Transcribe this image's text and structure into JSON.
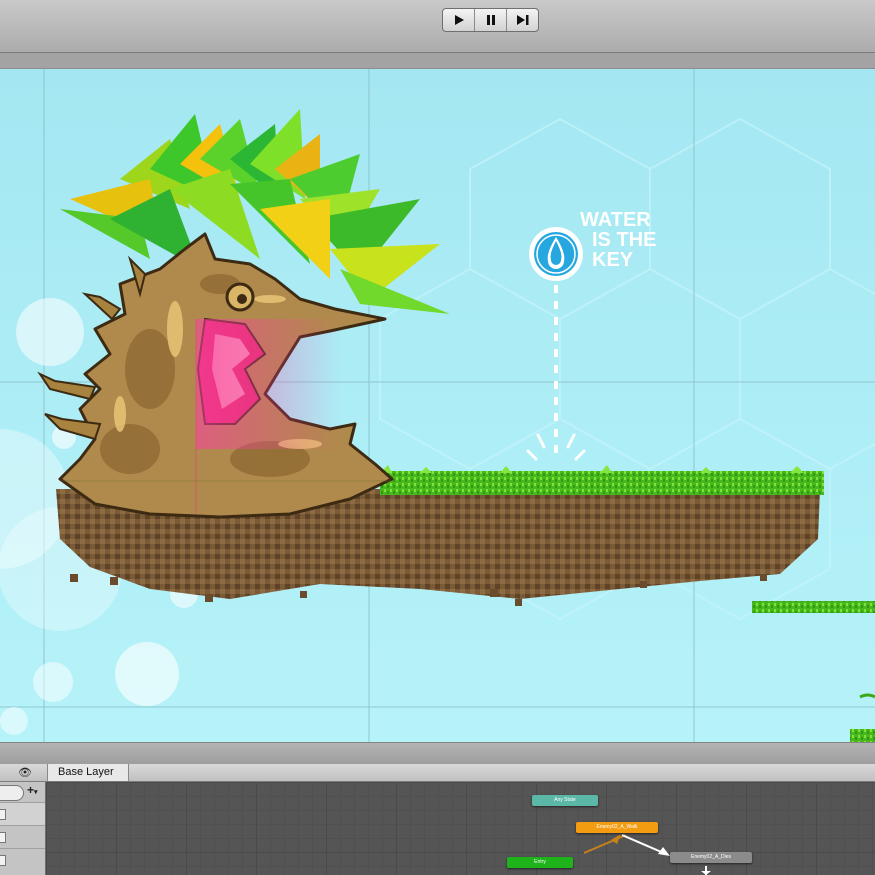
{
  "toolbar": {
    "play_icon": "play-icon",
    "pause_icon": "pause-icon",
    "step_icon": "step-forward-icon"
  },
  "scene": {
    "sign_line1": "WATER",
    "sign_line2": "IS THE",
    "sign_line3": "KEY",
    "sign_icon": "water-drop-icon"
  },
  "animator": {
    "layer_tab": "Base Layer",
    "eye_icon": "eye-icon",
    "add_icon": "plus-icon",
    "states": {
      "any_state": "Any State",
      "walk": "Enemy02_A_Walk",
      "dies": "Enemy02_A_Dies",
      "entry": "Entry"
    }
  },
  "colors": {
    "sky": "#a9ecf4",
    "grass": "#4cc21f",
    "dirt": "#7b5a36",
    "any_state": "#5bb8a6",
    "default_state": "#f39c11",
    "normal_state": "#8b8b8b",
    "entry_state": "#1fb31b"
  }
}
